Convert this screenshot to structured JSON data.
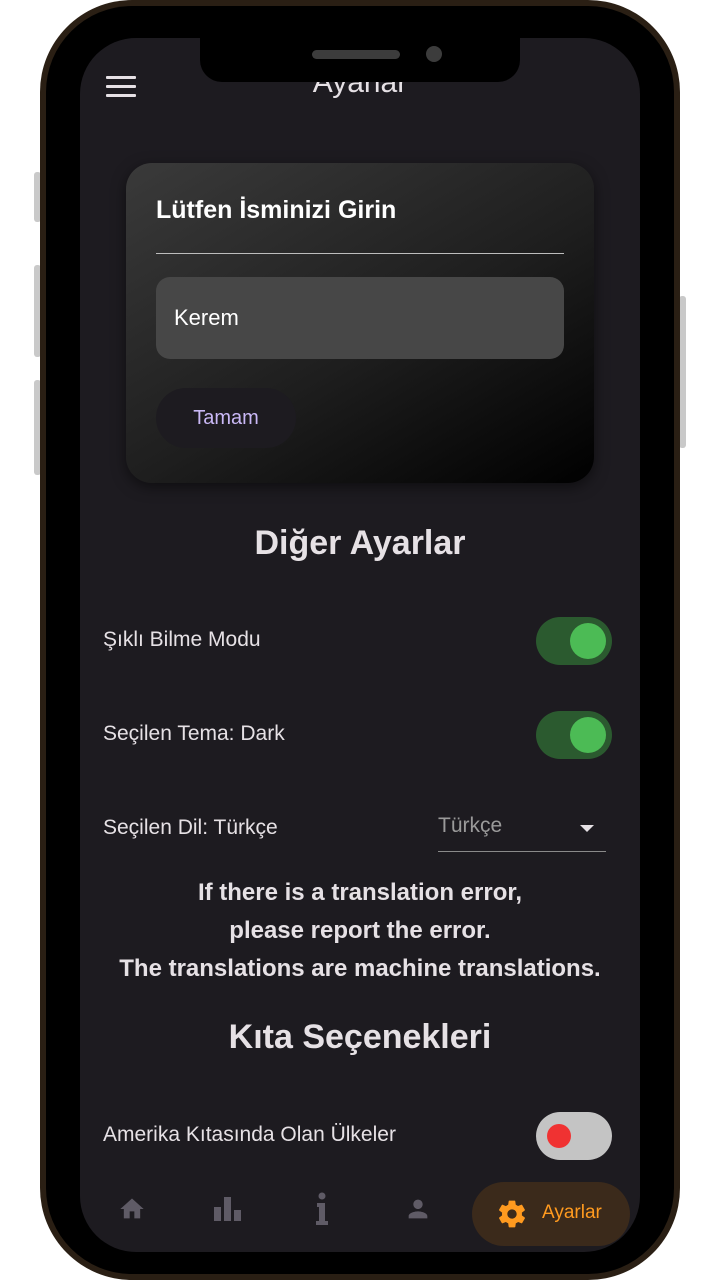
{
  "app_bar": {
    "title": "Ayarlar"
  },
  "name_card": {
    "title": "Lütfen İsminizi Girin",
    "input_value": "Kerem",
    "ok_label": "Tamam"
  },
  "other_settings": {
    "heading": "Diğer Ayarlar",
    "choice_mode": {
      "label": "Şıklı Bilme Modu",
      "enabled": true
    },
    "theme": {
      "label": "Seçilen Tema: Dark",
      "enabled": true
    },
    "language": {
      "label": "Seçilen Dil: Türkçe",
      "selected": "Türkçe"
    }
  },
  "notice": {
    "line1": "If there is a translation error,",
    "line2": "please report the error.",
    "line3": "The translations are machine translations."
  },
  "continents": {
    "heading": "Kıta Seçenekleri",
    "america": {
      "label": "Amerika Kıtasında Olan Ülkeler",
      "enabled": false
    }
  },
  "bottom_nav": {
    "items": [
      {
        "icon": "home-icon"
      },
      {
        "icon": "bar-chart-icon"
      },
      {
        "icon": "info-icon"
      },
      {
        "icon": "person-icon"
      },
      {
        "icon": "settings-gear-icon",
        "label": "Ayarlar",
        "active": true
      }
    ]
  },
  "colors": {
    "screen_bg": "#1d1b20",
    "switch_on_track": "#2b5a2f",
    "switch_on_thumb": "#4cbb55",
    "switch_off_thumb": "#f03232",
    "active_nav_accent": "#ff9a1f"
  }
}
